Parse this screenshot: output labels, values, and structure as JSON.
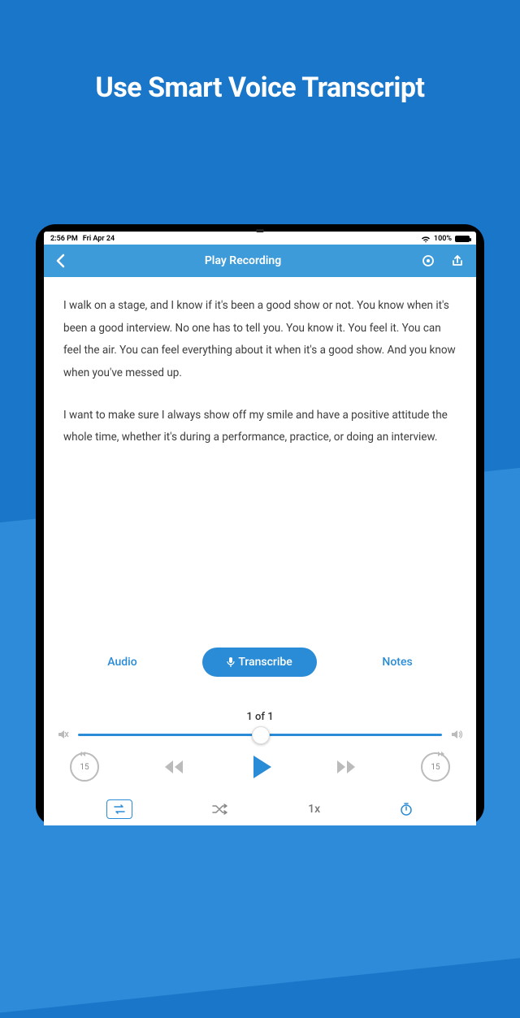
{
  "marketing": {
    "headline": "Use Smart Voice Transcript"
  },
  "status": {
    "time": "2:56 PM",
    "date": "Fri Apr 24",
    "battery": "100%"
  },
  "nav": {
    "title": "Play Recording"
  },
  "transcript": {
    "p1": "I walk on a stage, and I know if it's been  a good show or not. You know when it's  been a good interview. No one has to  tell you. You know it. You feel it. You can  feel the air. You can feel everything about it when it's a good show.  And you know when you've messed up.",
    "p2": "I want to make sure I always show off my smile and have a positive attitude the whole time, whether it's during a performance, practice, or doing an interview."
  },
  "tabs": {
    "audio": "Audio",
    "transcribe": "Transcribe",
    "notes": "Notes"
  },
  "player": {
    "counter": "1 of 1",
    "skipSeconds": "15",
    "speed": "1x"
  }
}
